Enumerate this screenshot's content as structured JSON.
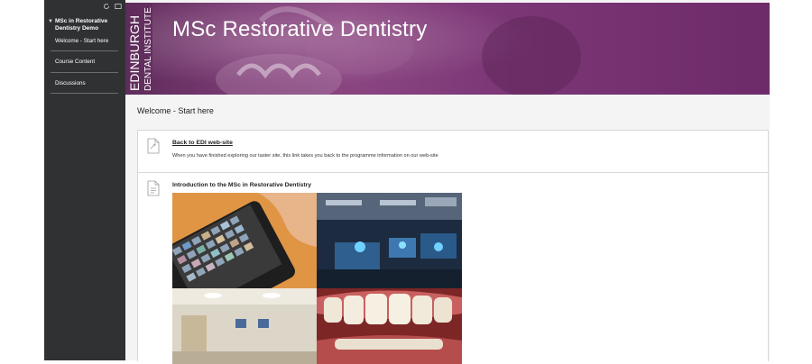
{
  "sidebar": {
    "course_title": "MSc in Restorative Dentistry Demo",
    "items": [
      {
        "label": "Welcome - Start here"
      },
      {
        "label": "Course Content"
      },
      {
        "label": "Discussions"
      }
    ]
  },
  "banner": {
    "vertical_text_1": "EDINBURGH",
    "vertical_text_2": "DENTAL INSTITUTE",
    "title": "MSc Restorative Dentistry"
  },
  "page": {
    "title": "Welcome - Start here"
  },
  "content": {
    "items": [
      {
        "title": "Back to EDI web-site",
        "description": "When you have finished exploring our taster site, this link takes you back to the programme information on our web-site"
      },
      {
        "title": "Introduction to the MSc in Restorative Dentistry"
      }
    ]
  },
  "colors": {
    "sidebar_bg": "#2f3133",
    "banner_purple": "#7a3a74",
    "page_bg": "#f4f4f4"
  },
  "icons": {
    "refresh": "refresh-icon",
    "folder": "folder-icon",
    "document": "document-icon"
  }
}
